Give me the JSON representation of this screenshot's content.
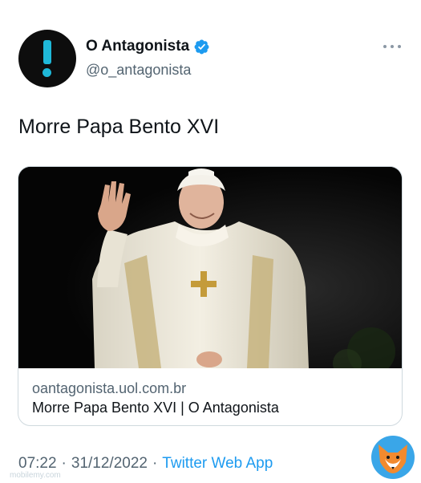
{
  "account": {
    "display_name": "O Antagonista",
    "handle": "@o_antagonista",
    "avatar_icon": "exclamation-mark-logo",
    "verified_icon": "verified-badge-icon",
    "avatar_bg": "#0d0d0d",
    "avatar_fg": "#1fb8d8"
  },
  "tweet": {
    "text": "Morre Papa Bento XVI"
  },
  "card": {
    "image_icon": "pope-waving-photo",
    "domain": "oantagonista.uol.com.br",
    "title": "Morre Papa Bento XVI | O Antagonista"
  },
  "meta": {
    "time": "07:22",
    "separator": "·",
    "date": "31/12/2022",
    "source": "Twitter Web App"
  },
  "overlay": {
    "watermark_icon": "fox-logo",
    "watermark_text": "mobilemy.com"
  },
  "colors": {
    "link": "#1d9bf0",
    "secondary_text": "#536471",
    "verified": "#1d9bf0"
  }
}
